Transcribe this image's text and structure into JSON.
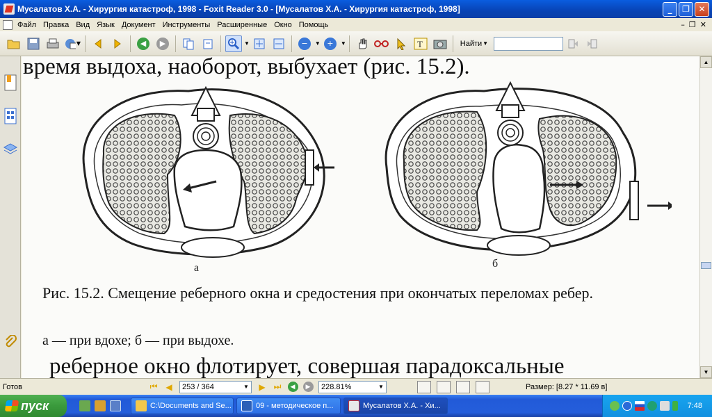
{
  "window": {
    "title": "Мусалатов Х.А. - Хирургия катастроф, 1998 - Foxit Reader 3.0 - [Мусалатов Х.А. - Хирургия катастроф, 1998]",
    "buttons": {
      "minimize": "_",
      "maximize": "❐",
      "close": "✕"
    }
  },
  "menu": [
    "Файл",
    "Правка",
    "Вид",
    "Язык",
    "Документ",
    "Инструменты",
    "Расширенные",
    "Окно",
    "Помощь"
  ],
  "mdi_buttons": {
    "minimize": "–",
    "restore": "❐",
    "close": "✕"
  },
  "toolbar": {
    "find_label": "Найти",
    "find_value": "",
    "icons": [
      "open-icon",
      "save-icon",
      "print-icon",
      "email-icon",
      "previous-view-icon",
      "next-view-icon",
      "back-icon",
      "forward-icon",
      "extract-icon",
      "rotate-icon",
      "zoom-in-tool-icon",
      "fit-page-icon",
      "fit-width-icon",
      "zoom-out-icon",
      "zoom-in-icon",
      "hand-tool-icon",
      "loupe-icon",
      "select-tool-icon",
      "text-select-icon",
      "snapshot-icon",
      "find-prev-icon",
      "find-next-icon"
    ]
  },
  "document": {
    "top_text": "время выдоха, наоборот, выбухает (рис. 15.2).",
    "figure_labels": {
      "a": "а",
      "b": "б"
    },
    "caption": "Рис. 15.2. Смещение реберного окна и средостения при окончатых переломах ребер.",
    "subcaption": "а — при вдохе; б — при выдохе.",
    "bottom_text": "реберное окно флотирует, совершая парадоксальные"
  },
  "status": {
    "ready": "Готов",
    "page": "253 / 364",
    "zoom": "228.81%",
    "size": "Размер: [8.27 * 11.69 в]"
  },
  "taskbar": {
    "start": "пуск",
    "tasks": [
      {
        "label": "C:\\Documents and Se...",
        "icon": "folder-icon"
      },
      {
        "label": "09 - методическое п...",
        "icon": "word-icon"
      },
      {
        "label": "Мусалатов Х.А. - Хи...",
        "icon": "foxit-icon"
      }
    ],
    "clock": "7:48"
  },
  "colors": {
    "titlebar": "#0a4fc8",
    "taskbar": "#245edb",
    "start": "#3a9a3c",
    "tray": "#1290e0"
  }
}
